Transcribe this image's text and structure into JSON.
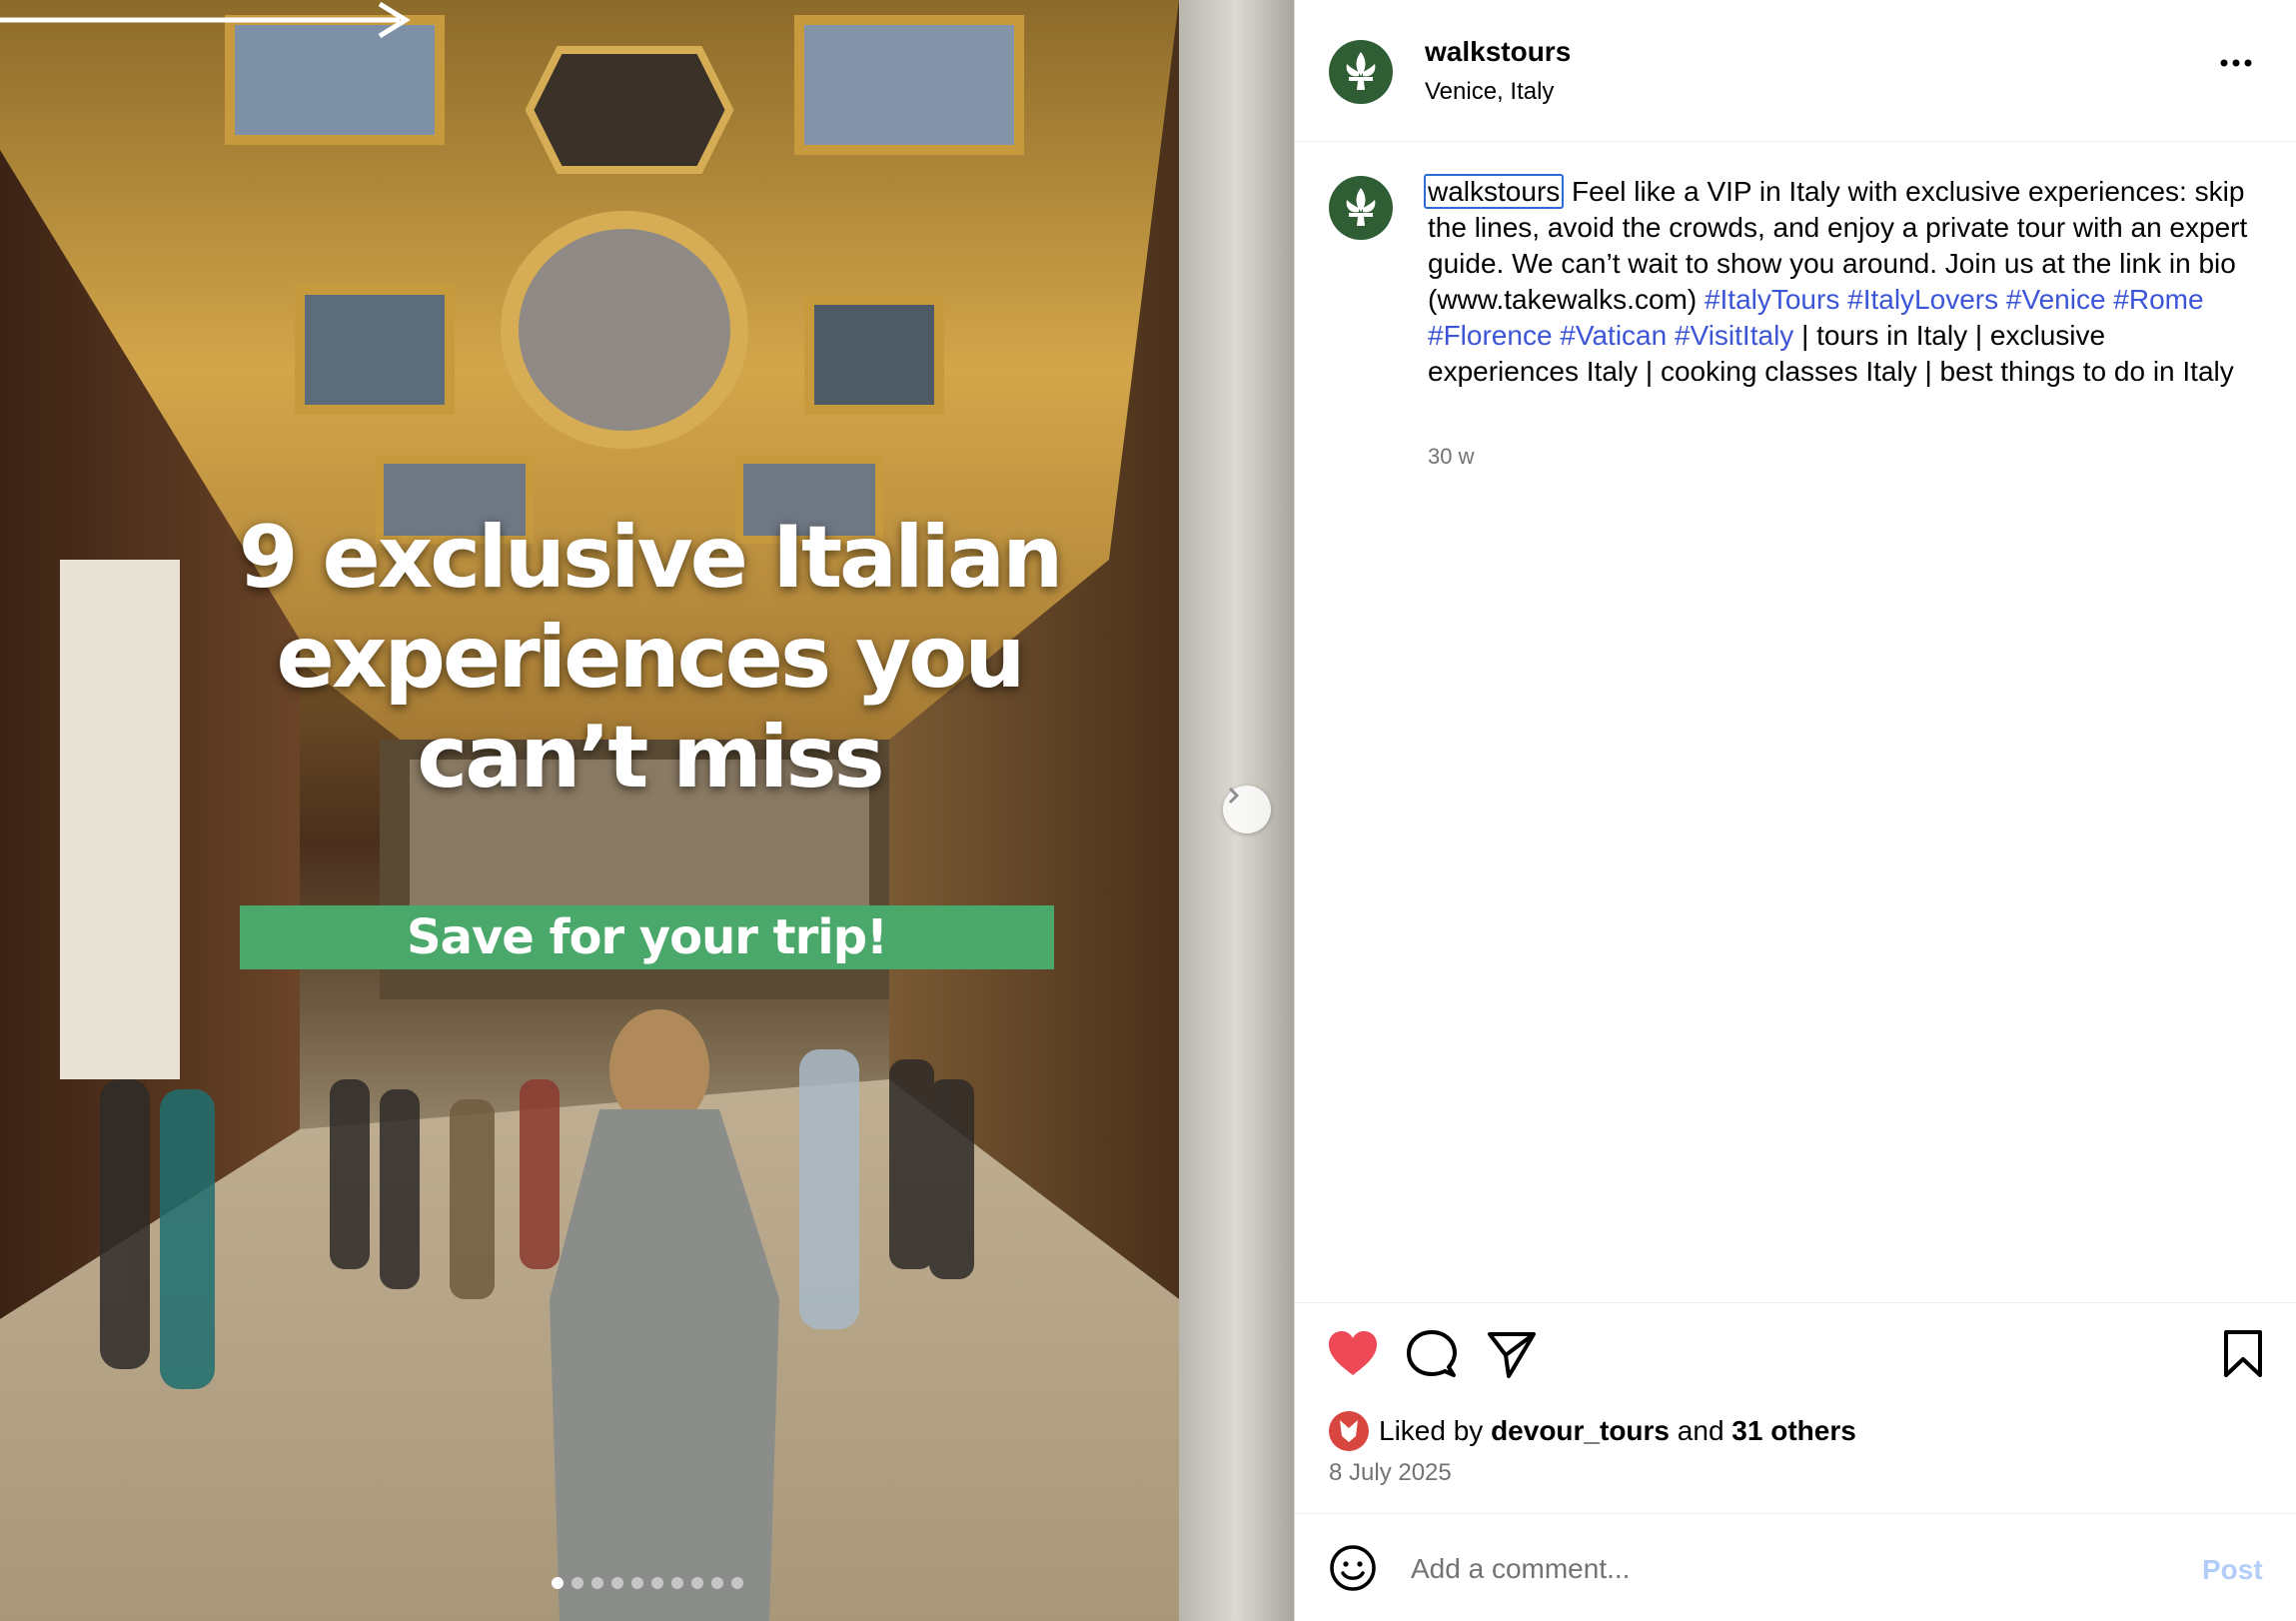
{
  "media": {
    "overlay_title": "9 exclusive Italian\nexperiences you\ncan’t miss",
    "banner_text": "Save for your trip!",
    "carousel_count": 10,
    "carousel_active_index": 0
  },
  "header": {
    "username": "walkstours",
    "location": "Venice, Italy",
    "more_icon": "more-horizontal-icon"
  },
  "caption": {
    "username": "walkstours",
    "text_1": "Feel like a VIP in Italy with exclusive experiences: skip the lines, avoid the crowds, and enjoy a private tour with an expert guide. We can’t wait to show you around. Join us at the link in bio (www.takewalks.com) ",
    "hashtags": [
      "#ItalyTours",
      "#ItalyLovers",
      "#Venice",
      "#Rome",
      "#Florence",
      "#Vatican",
      "#VisitItaly"
    ],
    "text_2": " | tours in Italy | exclusive experiences Italy | cooking classes Italy | best things to do in Italy",
    "time_ago": "30 w"
  },
  "actions": {
    "like_icon": "heart-filled-icon",
    "comment_icon": "comment-icon",
    "share_icon": "share-icon",
    "save_icon": "bookmark-icon",
    "liked_state": true
  },
  "likes": {
    "prefix": "Liked by ",
    "first_user": "devour_tours",
    "middle": " and ",
    "others": "31 others"
  },
  "post_date": "8 July 2025",
  "comment": {
    "placeholder": "Add a comment...",
    "post_label": "Post"
  },
  "colors": {
    "avatar_green": "#2f5d34",
    "like_red": "#ed4956",
    "hashtag_blue": "#3b55d6",
    "banner_green": "#4aa86a",
    "post_disabled": "#b3cdf9"
  }
}
